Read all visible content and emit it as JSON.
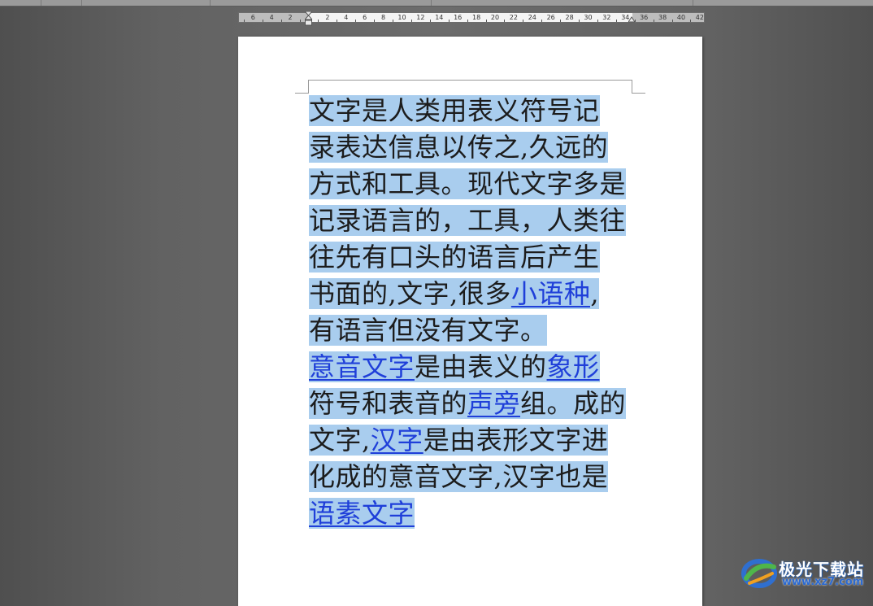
{
  "ruler": {
    "ticks": [
      "6",
      "4",
      "2",
      "2",
      "4",
      "6",
      "8",
      "10",
      "12",
      "14",
      "16",
      "18",
      "20",
      "22",
      "24",
      "26",
      "28",
      "30",
      "32",
      "34",
      "36",
      "38",
      "40",
      "42"
    ]
  },
  "document": {
    "lines": [
      [
        {
          "t": "文字是人类用表义符号记"
        }
      ],
      [
        {
          "t": "录表达信息以传之,久远的"
        }
      ],
      [
        {
          "t": "方式和工具。现代文字多是"
        }
      ],
      [
        {
          "t": "记录语言的，工具，人类往"
        }
      ],
      [
        {
          "t": "往先有口头的语言后产生"
        }
      ],
      [
        {
          "t": "书面的,文字,很多"
        },
        {
          "t": "小语种",
          "link": true
        },
        {
          "t": ","
        }
      ],
      [
        {
          "t": "有语言但没有文字。"
        }
      ],
      [
        {
          "t": "意音文字",
          "link": true
        },
        {
          "t": "是由表义的"
        },
        {
          "t": "象形",
          "link": true
        }
      ],
      [
        {
          "t": "符号和表音的"
        },
        {
          "t": "声旁",
          "link": true
        },
        {
          "t": "组。成的"
        }
      ],
      [
        {
          "t": "文字,"
        },
        {
          "t": "汉字",
          "link": true
        },
        {
          "t": "是由表形文字进"
        }
      ],
      [
        {
          "t": "化成的意音文字,汉字也是"
        }
      ],
      [
        {
          "t": "语素文字",
          "link": true
        },
        {
          "t": " "
        }
      ]
    ]
  },
  "watermark": {
    "brand": "极光下载站",
    "url": "www.xz7.com"
  },
  "colors": {
    "selection": "#a9cdee",
    "link": "#1f3fd9",
    "page": "#ffffff",
    "workspace": "#6c6c6c"
  }
}
